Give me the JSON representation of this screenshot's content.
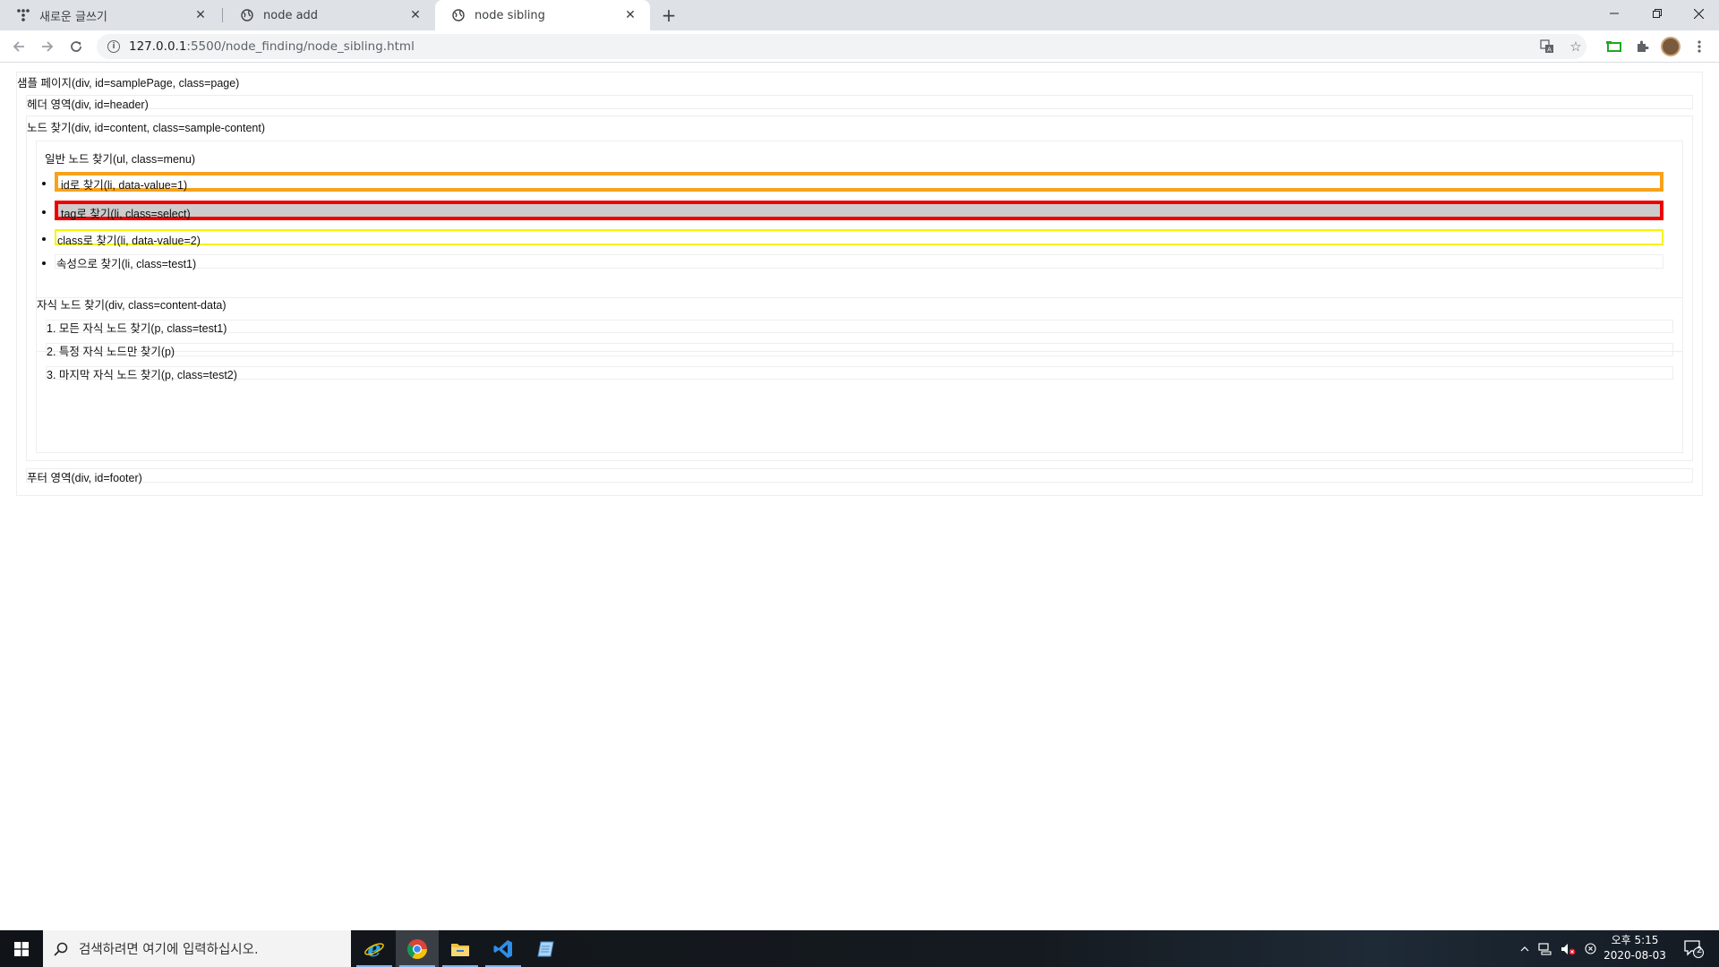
{
  "browser": {
    "tabs": [
      {
        "title": "새로운 글쓰기",
        "icon": "tistory-icon",
        "active": false
      },
      {
        "title": "node add",
        "icon": "globe-icon",
        "active": false
      },
      {
        "title": "node sibling",
        "icon": "globe-icon",
        "active": true
      }
    ],
    "address": {
      "host": "127.0.0.1",
      "path": ":5500/node_finding/node_sibling.html"
    }
  },
  "page": {
    "sample_page": "샘플 페이지(div, id=samplePage, class=page)",
    "header": "헤더 영역(div, id=header)",
    "content": "노드 찾기(div, id=content, class=sample-content)",
    "menu": {
      "title": "일반 노드 찾기(ul, class=menu)",
      "items": [
        {
          "label": "id로 찾기(li, data-value=1)",
          "border_color": "#f7a21b",
          "background": "#ffffff"
        },
        {
          "label": "tag로 찾기(li, class=select)",
          "border_color": "#ee0000",
          "background": "#cccccc"
        },
        {
          "label": "class로 찾기(li, data-value=2)",
          "border_color": "#f5f500",
          "background": "#ffffff"
        },
        {
          "label": "속성으로 찾기(li, class=test1)",
          "border_color": "#eeeeee",
          "background": "#ffffff"
        }
      ]
    },
    "content_data": {
      "title": "자식 노드 찾기(div, class=content-data)",
      "items": [
        "1. 모든 자식 노드 찾기(p, class=test1)",
        "2. 특정 자식 노드만 찾기(p)",
        "3. 마지막 자식 노드 찾기(p, class=test2)"
      ]
    },
    "footer": "푸터 영역(div, id=footer)"
  },
  "taskbar": {
    "search_placeholder": "검색하려면 여기에 입력하십시오.",
    "clock": {
      "time": "오후 5:15",
      "date": "2020-08-03"
    },
    "notification_count": "2"
  }
}
